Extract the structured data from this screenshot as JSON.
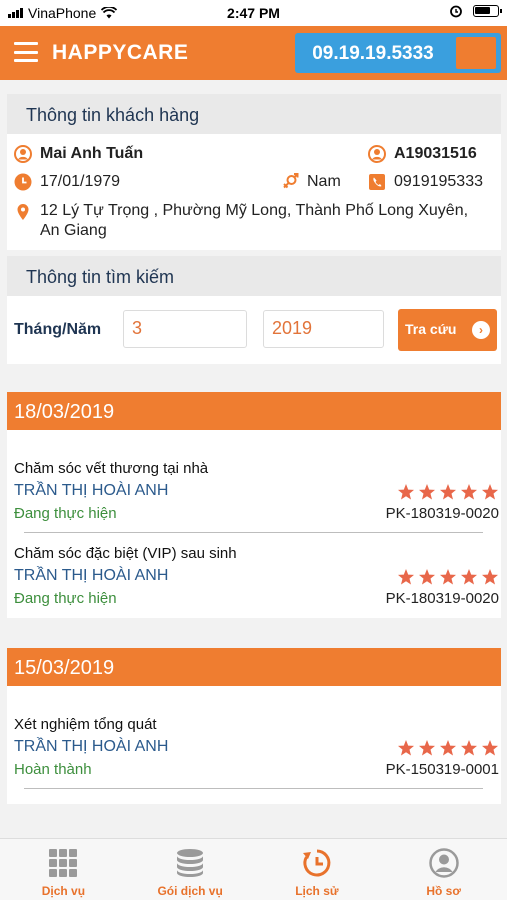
{
  "status_bar": {
    "carrier": "VinaPhone",
    "time": "2:47 PM"
  },
  "header": {
    "brand": "HAPPYCARE",
    "hotline": "09.19.19.5333"
  },
  "customer": {
    "section_title": "Thông tin khách hàng",
    "name": "Mai Anh Tuấn",
    "code": "A19031516",
    "dob": "17/01/1979",
    "gender": "Nam",
    "phone": "0919195333",
    "address": "12 Lý Tự Trọng , Phường Mỹ Long, Thành Phố Long Xuyên, An Giang"
  },
  "search": {
    "section_title": "Thông tin tìm kiếm",
    "label": "Tháng/Năm",
    "month": "3",
    "year": "2019",
    "button": "Tra cứu"
  },
  "history": [
    {
      "date": "18/03/2019",
      "items": [
        {
          "title": "Chăm sóc vết thương tại nhà",
          "staff": "TRẦN THỊ  HOÀI ANH",
          "status": "Đang thực hiện",
          "code": "PK-180319-0020",
          "rating": 5
        },
        {
          "title": "Chăm sóc đặc biệt (VIP) sau sinh",
          "staff": "TRẦN THỊ  HOÀI ANH",
          "status": "Đang thực hiện",
          "code": "PK-180319-0020",
          "rating": 5
        }
      ]
    },
    {
      "date": "15/03/2019",
      "items": [
        {
          "title": "Xét nghiệm tổng quát",
          "staff": "TRẦN THỊ  HOÀI ANH",
          "status": "Hoàn thành",
          "code": "PK-150319-0001",
          "rating": 5
        }
      ]
    }
  ],
  "tabs": [
    {
      "label": "Dịch vụ",
      "icon": "grid-icon"
    },
    {
      "label": "Gói dịch vụ",
      "icon": "database-icon"
    },
    {
      "label": "Lịch sử",
      "icon": "history-icon"
    },
    {
      "label": "Hồ sơ",
      "icon": "profile-icon"
    }
  ],
  "colors": {
    "accent": "#ef7d30",
    "hotline_bg": "#3a9fde",
    "status_green": "#3d8f3d",
    "staff_blue": "#2b5a8c"
  }
}
